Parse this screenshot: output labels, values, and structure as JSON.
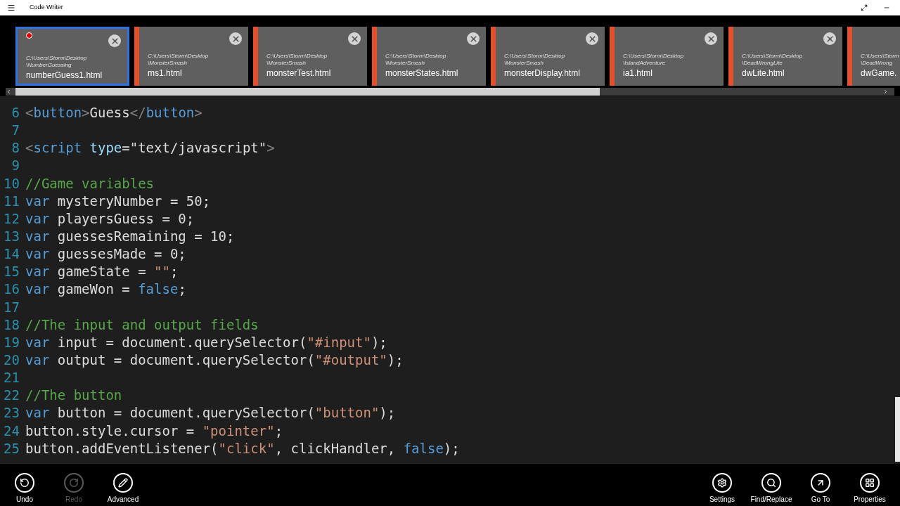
{
  "window": {
    "title": "Code Writer"
  },
  "tabs": [
    {
      "path": [
        "C:\\Users\\Storm\\Desktop",
        "\\NumberGuessing"
      ],
      "name": "numberGuess1.html",
      "selected": true,
      "modified": true
    },
    {
      "path": [
        "C:\\Users\\Storm\\Desktop",
        "\\MonsterSmash"
      ],
      "name": "ms1.html",
      "selected": false,
      "modified": false
    },
    {
      "path": [
        "C:\\Users\\Storm\\Desktop",
        "\\MonsterSmash"
      ],
      "name": "monsterTest.html",
      "selected": false,
      "modified": false
    },
    {
      "path": [
        "C:\\Users\\Storm\\Desktop",
        "\\MonsterSmash"
      ],
      "name": "monsterStates.html",
      "selected": false,
      "modified": false
    },
    {
      "path": [
        "C:\\Users\\Storm\\Desktop",
        "\\MonsterSmash"
      ],
      "name": "monsterDisplay.html",
      "selected": false,
      "modified": false
    },
    {
      "path": [
        "C:\\Users\\Storm\\Desktop",
        "\\IslandAdventure"
      ],
      "name": "ia1.html",
      "selected": false,
      "modified": false
    },
    {
      "path": [
        "C:\\Users\\Storm\\Desktop",
        "\\DeadWrongLite"
      ],
      "name": "dwLite.html",
      "selected": false,
      "modified": false
    },
    {
      "path": [
        "C:\\Users\\Storm",
        "\\DeadWrong"
      ],
      "name": "dwGame.",
      "selected": false,
      "modified": false
    }
  ],
  "editor": {
    "lines": [
      {
        "number": "6",
        "tokens": [
          {
            "kind": "punct",
            "text": "<"
          },
          {
            "kind": "tag",
            "text": "button"
          },
          {
            "kind": "punct",
            "text": ">"
          },
          {
            "kind": "plain",
            "text": "Guess"
          },
          {
            "kind": "punct",
            "text": "</"
          },
          {
            "kind": "tag",
            "text": "button"
          },
          {
            "kind": "punct",
            "text": ">"
          }
        ]
      },
      {
        "number": "7"
      },
      {
        "number": "8",
        "tokens": [
          {
            "kind": "punct",
            "text": "<"
          },
          {
            "kind": "tag",
            "text": "script "
          },
          {
            "kind": "attr",
            "text": "type"
          },
          {
            "kind": "plain",
            "text": "=\"text/javascript\""
          },
          {
            "kind": "punct",
            "text": ">"
          }
        ]
      },
      {
        "number": "9"
      },
      {
        "number": "10",
        "tokens": [
          {
            "kind": "comment",
            "text": "//Game variables"
          }
        ]
      },
      {
        "number": "11",
        "tokens": [
          {
            "kind": "keyword",
            "text": "var"
          },
          {
            "kind": "plain",
            "text": " mysteryNumber = 50;"
          }
        ]
      },
      {
        "number": "12",
        "tokens": [
          {
            "kind": "keyword",
            "text": "var"
          },
          {
            "kind": "plain",
            "text": " playersGuess = 0;"
          }
        ]
      },
      {
        "number": "13",
        "tokens": [
          {
            "kind": "keyword",
            "text": "var"
          },
          {
            "kind": "plain",
            "text": " guessesRemaining = 10;"
          }
        ]
      },
      {
        "number": "14",
        "tokens": [
          {
            "kind": "keyword",
            "text": "var"
          },
          {
            "kind": "plain",
            "text": " guessesMade = 0;"
          }
        ]
      },
      {
        "number": "15",
        "tokens": [
          {
            "kind": "keyword",
            "text": "var"
          },
          {
            "kind": "plain",
            "text": " gameState = "
          },
          {
            "kind": "string",
            "text": "\"\""
          },
          {
            "kind": "plain",
            "text": ";"
          }
        ]
      },
      {
        "number": "16",
        "tokens": [
          {
            "kind": "keyword",
            "text": "var"
          },
          {
            "kind": "plain",
            "text": " gameWon = "
          },
          {
            "kind": "keyword",
            "text": "false"
          },
          {
            "kind": "plain",
            "text": ";"
          }
        ]
      },
      {
        "number": "17"
      },
      {
        "number": "18",
        "tokens": [
          {
            "kind": "comment",
            "text": "//The input and output fields"
          }
        ]
      },
      {
        "number": "19",
        "tokens": [
          {
            "kind": "keyword",
            "text": "var"
          },
          {
            "kind": "plain",
            "text": " input = document.querySelector("
          },
          {
            "kind": "string",
            "text": "\"#input\""
          },
          {
            "kind": "plain",
            "text": ");"
          }
        ]
      },
      {
        "number": "20",
        "tokens": [
          {
            "kind": "keyword",
            "text": "var"
          },
          {
            "kind": "plain",
            "text": " output = document.querySelector("
          },
          {
            "kind": "string",
            "text": "\"#output\""
          },
          {
            "kind": "plain",
            "text": ");"
          }
        ]
      },
      {
        "number": "21"
      },
      {
        "number": "22",
        "tokens": [
          {
            "kind": "comment",
            "text": "//The button"
          }
        ]
      },
      {
        "number": "23",
        "tokens": [
          {
            "kind": "keyword",
            "text": "var"
          },
          {
            "kind": "plain",
            "text": " button = document.querySelector("
          },
          {
            "kind": "string",
            "text": "\"button\""
          },
          {
            "kind": "plain",
            "text": ");"
          }
        ]
      },
      {
        "number": "24",
        "tokens": [
          {
            "kind": "plain",
            "text": "button.style.cursor = "
          },
          {
            "kind": "string",
            "text": "\"pointer\""
          },
          {
            "kind": "plain",
            "text": ";"
          }
        ]
      },
      {
        "number": "25",
        "tokens": [
          {
            "kind": "plain",
            "text": "button.addEventListener("
          },
          {
            "kind": "string",
            "text": "\"click\""
          },
          {
            "kind": "plain",
            "text": ", clickHandler, "
          },
          {
            "kind": "keyword",
            "text": "false"
          },
          {
            "kind": "plain",
            "text": ");"
          }
        ]
      }
    ]
  },
  "app_bar": {
    "left": [
      {
        "kind": "undo",
        "label": "Undo",
        "disabled": false
      },
      {
        "kind": "redo",
        "label": "Redo",
        "disabled": true
      },
      {
        "kind": "advanced",
        "label": "Advanced",
        "disabled": false
      }
    ],
    "right": [
      {
        "kind": "settings",
        "label": "Settings",
        "disabled": false
      },
      {
        "kind": "find",
        "label": "Find/Replace",
        "disabled": false
      },
      {
        "kind": "goto",
        "label": "Go To",
        "disabled": false
      },
      {
        "kind": "properties",
        "label": "Properties",
        "disabled": false
      }
    ]
  }
}
